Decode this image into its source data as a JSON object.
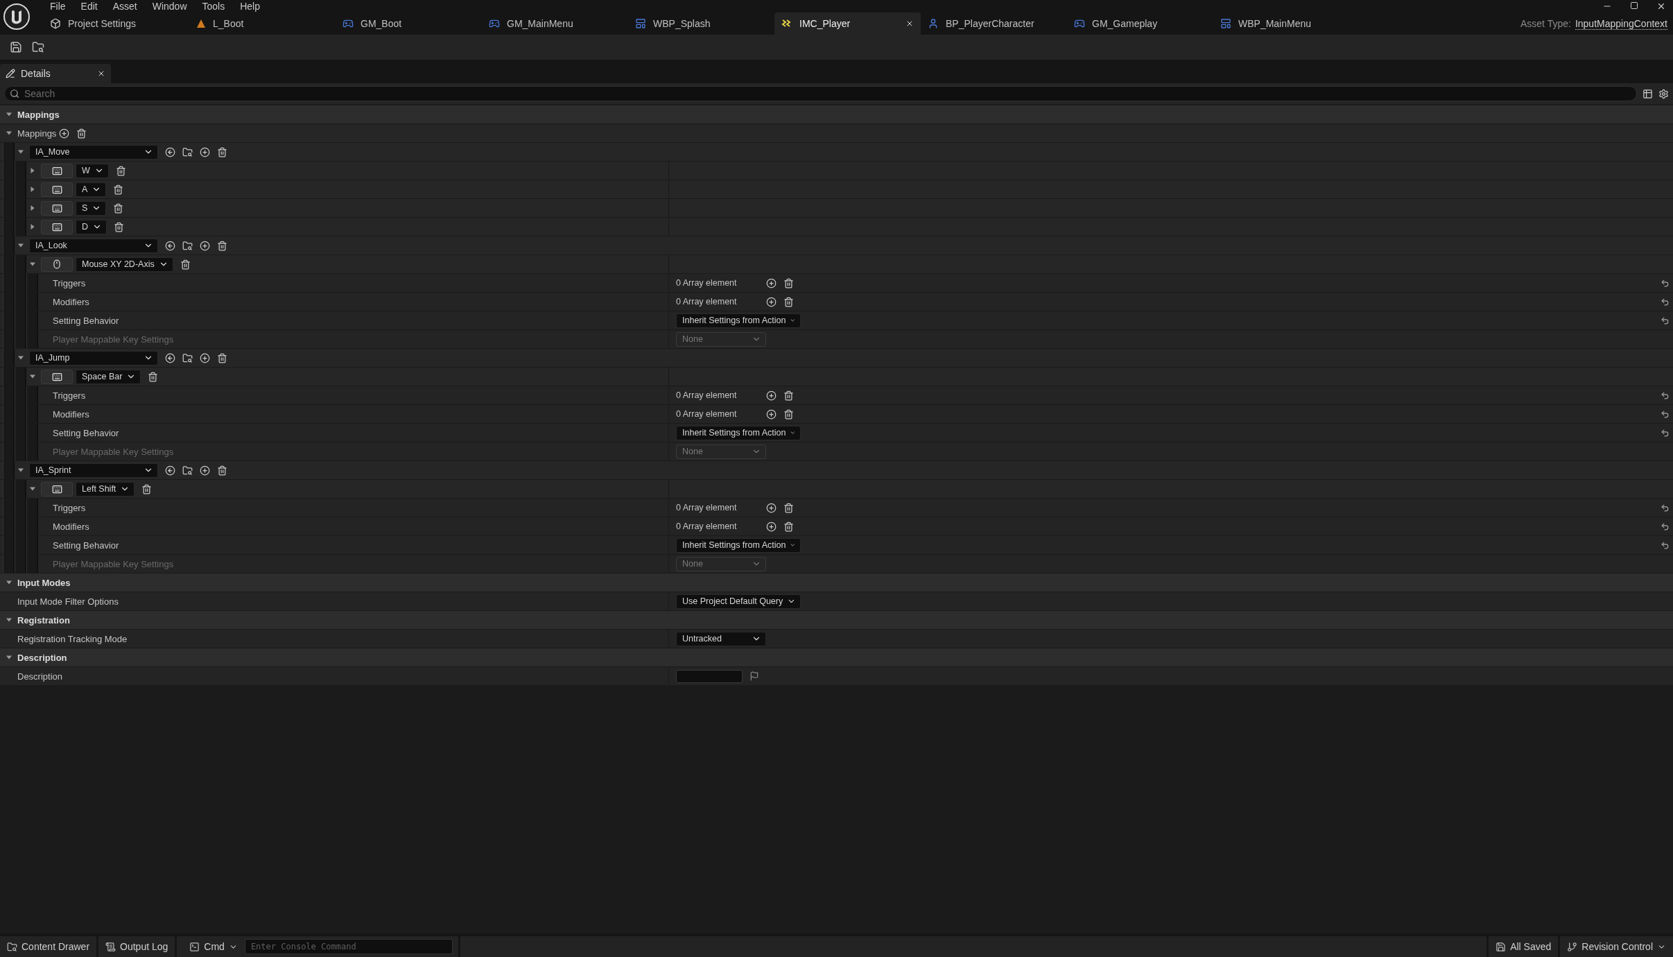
{
  "menu": [
    "File",
    "Edit",
    "Asset",
    "Window",
    "Tools",
    "Help"
  ],
  "tabs": [
    {
      "label": "Project Settings",
      "kind": "settings",
      "selected": false
    },
    {
      "label": "L_Boot",
      "kind": "level",
      "selected": false
    },
    {
      "label": "GM_Boot",
      "kind": "gamemode",
      "selected": false
    },
    {
      "label": "GM_MainMenu",
      "kind": "gamemode",
      "selected": false
    },
    {
      "label": "WBP_Splash",
      "kind": "widget",
      "selected": false
    },
    {
      "label": "IMC_Player",
      "kind": "mapping",
      "selected": true
    },
    {
      "label": "BP_PlayerCharacter",
      "kind": "character",
      "selected": false
    },
    {
      "label": "GM_Gameplay",
      "kind": "gamemode",
      "selected": false
    },
    {
      "label": "WBP_MainMenu",
      "kind": "widget",
      "selected": false
    }
  ],
  "asset_type": {
    "label": "Asset Type:",
    "value": "InputMappingContext"
  },
  "panel_tab": "Details",
  "search": {
    "placeholder": "Search"
  },
  "sections": [
    {
      "title": "Mappings",
      "expanded": true,
      "children": [
        {
          "kind": "array",
          "label": "Mappings",
          "expanded": true,
          "children": [
            {
              "kind": "action",
              "action": "IA_Move",
              "expanded": true,
              "children": [
                {
                  "kind": "keyboard",
                  "key": "W",
                  "expanded": false
                },
                {
                  "kind": "keyboard",
                  "key": "A",
                  "expanded": false
                },
                {
                  "kind": "keyboard",
                  "key": "S",
                  "expanded": false
                },
                {
                  "kind": "keyboard",
                  "key": "D",
                  "expanded": false
                }
              ]
            },
            {
              "kind": "action",
              "action": "IA_Look",
              "expanded": true,
              "children": [
                {
                  "kind": "mouse",
                  "key": "Mouse XY 2D-Axis",
                  "expanded": true,
                  "children": [
                    {
                      "kind": "property",
                      "label": "Triggers",
                      "disabled": false,
                      "resettable": true,
                      "value": {
                        "kind": "array",
                        "text": "0 Array element"
                      }
                    },
                    {
                      "kind": "property",
                      "label": "Modifiers",
                      "disabled": false,
                      "resettable": true,
                      "value": {
                        "kind": "array",
                        "text": "0 Array element"
                      }
                    },
                    {
                      "kind": "property",
                      "label": "Setting Behavior",
                      "disabled": false,
                      "resettable": true,
                      "value": {
                        "kind": "dropdown",
                        "text": "Inherit Settings from Action",
                        "disabled": false
                      }
                    },
                    {
                      "kind": "property",
                      "label": "Player Mappable Key Settings",
                      "disabled": true,
                      "resettable": false,
                      "value": {
                        "kind": "dropdown",
                        "text": "None",
                        "disabled": true
                      }
                    }
                  ]
                }
              ]
            },
            {
              "kind": "action",
              "action": "IA_Jump",
              "expanded": true,
              "children": [
                {
                  "kind": "keyboard",
                  "key": "Space Bar",
                  "expanded": true,
                  "children": [
                    {
                      "kind": "property",
                      "label": "Triggers",
                      "disabled": false,
                      "resettable": true,
                      "value": {
                        "kind": "array",
                        "text": "0 Array element"
                      }
                    },
                    {
                      "kind": "property",
                      "label": "Modifiers",
                      "disabled": false,
                      "resettable": true,
                      "value": {
                        "kind": "array",
                        "text": "0 Array element"
                      }
                    },
                    {
                      "kind": "property",
                      "label": "Setting Behavior",
                      "disabled": false,
                      "resettable": true,
                      "value": {
                        "kind": "dropdown",
                        "text": "Inherit Settings from Action",
                        "disabled": false
                      }
                    },
                    {
                      "kind": "property",
                      "label": "Player Mappable Key Settings",
                      "disabled": true,
                      "resettable": false,
                      "value": {
                        "kind": "dropdown",
                        "text": "None",
                        "disabled": true
                      }
                    }
                  ]
                }
              ]
            },
            {
              "kind": "action",
              "action": "IA_Sprint",
              "expanded": true,
              "children": [
                {
                  "kind": "keyboard",
                  "key": "Left Shift",
                  "expanded": true,
                  "children": [
                    {
                      "kind": "property",
                      "label": "Triggers",
                      "disabled": false,
                      "resettable": true,
                      "value": {
                        "kind": "array",
                        "text": "0 Array element"
                      }
                    },
                    {
                      "kind": "property",
                      "label": "Modifiers",
                      "disabled": false,
                      "resettable": true,
                      "value": {
                        "kind": "array",
                        "text": "0 Array element"
                      }
                    },
                    {
                      "kind": "property",
                      "label": "Setting Behavior",
                      "disabled": false,
                      "resettable": true,
                      "value": {
                        "kind": "dropdown",
                        "text": "Inherit Settings from Action",
                        "disabled": false
                      }
                    },
                    {
                      "kind": "property",
                      "label": "Player Mappable Key Settings",
                      "disabled": true,
                      "resettable": false,
                      "value": {
                        "kind": "dropdown",
                        "text": "None",
                        "disabled": true
                      }
                    }
                  ]
                }
              ]
            }
          ]
        }
      ]
    },
    {
      "title": "Input Modes",
      "expanded": true,
      "children": [
        {
          "kind": "property",
          "label": "Input Mode Filter Options",
          "disabled": false,
          "resettable": false,
          "value": {
            "kind": "dropdown",
            "text": "Use Project Default Query",
            "disabled": false
          }
        }
      ]
    },
    {
      "title": "Registration",
      "expanded": true,
      "children": [
        {
          "kind": "property",
          "label": "Registration Tracking Mode",
          "disabled": false,
          "resettable": false,
          "value": {
            "kind": "dropdown",
            "text": "Untracked",
            "disabled": false
          }
        }
      ]
    },
    {
      "title": "Description",
      "expanded": true,
      "children": [
        {
          "kind": "property",
          "label": "Description",
          "disabled": false,
          "resettable": false,
          "value": {
            "kind": "textbox"
          }
        }
      ]
    }
  ],
  "status_bar": {
    "content_drawer": "Content Drawer",
    "output_log": "Output Log",
    "cmd": "Cmd",
    "console": {
      "placeholder": "Enter Console Command"
    },
    "saved": "All Saved",
    "revision": "Revision Control"
  }
}
